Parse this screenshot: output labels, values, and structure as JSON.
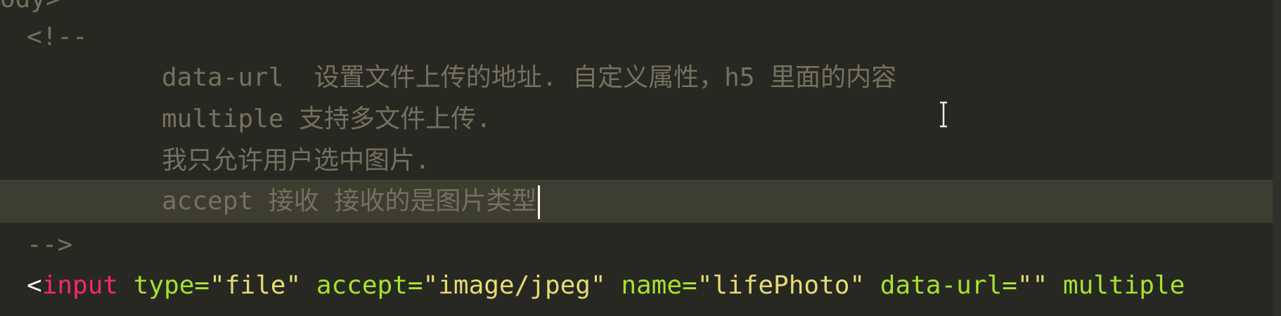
{
  "editor": {
    "lines": [
      {
        "text": "ody>"
      },
      {
        "text": "<!--"
      },
      {
        "text": "data-url  设置文件上传的地址. 自定义属性，h5 里面的内容"
      },
      {
        "text": "multiple 支持多文件上传."
      },
      {
        "text": "我只允许用户选中图片."
      },
      {
        "text": "accept 接收 接收的是图片类型"
      },
      {
        "text": "-->"
      }
    ],
    "input_line": {
      "open": "<",
      "tag": "input",
      "attr1_name": " type=",
      "attr1_value": "\"file\"",
      "attr2_name": " accept=",
      "attr2_value": "\"image/jpeg\"",
      "attr3_name": " name=",
      "attr3_value": "\"lifePhoto\"",
      "attr4_name": " data-url=",
      "attr4_value": "\"\"",
      "attr5_name": " multiple"
    }
  },
  "colors": {
    "background": "#272822",
    "comment": "#75715e",
    "tag": "#f92672",
    "attribute": "#a6e22e",
    "string": "#e6db74",
    "current_line": "#3e3d32"
  }
}
